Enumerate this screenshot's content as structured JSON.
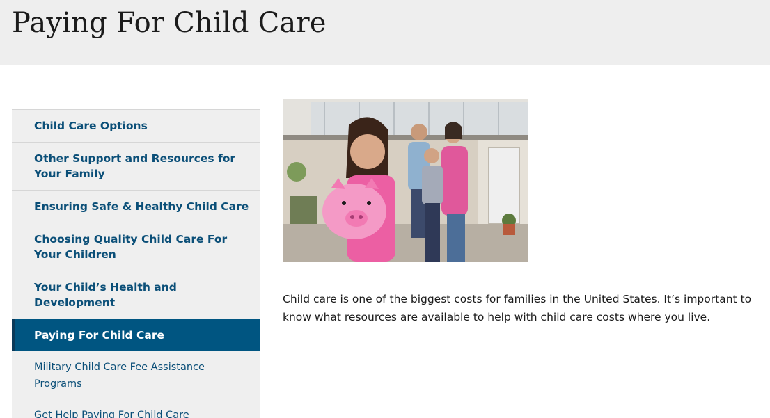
{
  "header": {
    "title": "Paying For Child Care"
  },
  "sidenav": {
    "items": [
      {
        "label": "Child Care Options"
      },
      {
        "label": "Other Support and Resources for Your Family"
      },
      {
        "label": "Ensuring Safe & Healthy Child Care"
      },
      {
        "label": "Choosing Quality Child Care For Your Children"
      },
      {
        "label": "Your Child’s Health and Development"
      },
      {
        "label": "Paying For Child Care",
        "active": true
      }
    ],
    "subitems": [
      {
        "label": "Military Child Care Fee Assistance Programs"
      },
      {
        "label": "Get Help Paying For Child Care"
      }
    ]
  },
  "main": {
    "image": {
      "icon": "family-piggy-bank-photo"
    },
    "intro": "Child care is one of the biggest costs for families in the United States. It’s important to know what resources are available to help with child care costs where you live."
  },
  "colors": {
    "header_bg": "#eeeeee",
    "nav_bg": "#efefef",
    "nav_link": "#0b4f78",
    "nav_active_bg": "#005581",
    "nav_active_text": "#ffffff"
  }
}
